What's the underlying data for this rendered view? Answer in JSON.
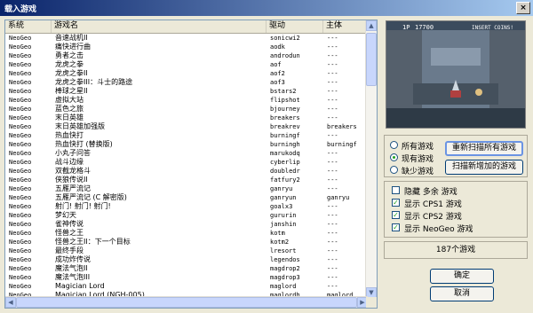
{
  "window": {
    "title": "载入游戏",
    "close_label": "×"
  },
  "columns": [
    "系统",
    "游戏名",
    "驱动",
    "主体"
  ],
  "rows": [
    [
      "NeoGeo",
      "音速战机II",
      "sonicwi2",
      "---"
    ],
    [
      "NeoGeo",
      "痛快进行曲",
      "aodk",
      "---"
    ],
    [
      "NeoGeo",
      "勇者之击",
      "androdun",
      "---"
    ],
    [
      "NeoGeo",
      "龙虎之拳",
      "aof",
      "---"
    ],
    [
      "NeoGeo",
      "龙虎之拳II",
      "aof2",
      "---"
    ],
    [
      "NeoGeo",
      "龙虎之拳III：斗士的路途",
      "aof3",
      "---"
    ],
    [
      "NeoGeo",
      "棒球之星II",
      "bstars2",
      "---"
    ],
    [
      "NeoGeo",
      "虚拟大站",
      "flipshot",
      "---"
    ],
    [
      "NeoGeo",
      "蓝色之旅",
      "bjourney",
      "---"
    ],
    [
      "NeoGeo",
      "末日英雄",
      "breakers",
      "---"
    ],
    [
      "NeoGeo",
      "末日英雄加强版",
      "breakrev",
      "breakers"
    ],
    [
      "NeoGeo",
      "热血快打",
      "burningf",
      "---"
    ],
    [
      "NeoGeo",
      "热血快打 (替换版)",
      "burningh",
      "burningf"
    ],
    [
      "NeoGeo",
      "小丸子问答",
      "marukodq",
      "---"
    ],
    [
      "NeoGeo",
      "战斗边缘",
      "cyberlip",
      "---"
    ],
    [
      "NeoGeo",
      "双截龙格斗",
      "doubledr",
      "---"
    ],
    [
      "NeoGeo",
      "侠狼传说II",
      "fatfury2",
      "---"
    ],
    [
      "NeoGeo",
      "五雁严流记",
      "ganryu",
      "---"
    ],
    [
      "NeoGeo",
      "五雁严流记 (C 解密版)",
      "ganryun",
      "ganryu"
    ],
    [
      "NeoGeo",
      "射门! 射门! 射门!",
      "goalx3",
      "---"
    ],
    [
      "NeoGeo",
      "梦幻天",
      "gururin",
      "---"
    ],
    [
      "NeoGeo",
      "雀神传说",
      "janshin",
      "---"
    ],
    [
      "NeoGeo",
      "怪兽之王",
      "kotm",
      "---"
    ],
    [
      "NeoGeo",
      "怪兽之王II：下一个目标",
      "kotm2",
      "---"
    ],
    [
      "NeoGeo",
      "最终手段",
      "lresort",
      "---"
    ],
    [
      "NeoGeo",
      "成功炸传说",
      "legendos",
      "---"
    ],
    [
      "NeoGeo",
      "魔法气泡II",
      "magdrop2",
      "---"
    ],
    [
      "NeoGeo",
      "魔法气泡III",
      "magdrop3",
      "---"
    ],
    [
      "NeoGeo",
      "Magician Lord",
      "maglord",
      "---"
    ],
    [
      "NeoGeo",
      "Magician Lord (NGH-005)",
      "maglordh",
      "maglord"
    ]
  ],
  "preview": {
    "score_label": "1P",
    "score": "17700",
    "insert_text": "INSERT COINS!"
  },
  "radio_options": [
    {
      "label": "所有游戏",
      "selected": false
    },
    {
      "label": "现有游戏",
      "selected": true
    },
    {
      "label": "缺少游戏",
      "selected": false
    }
  ],
  "buttons": {
    "rescan_all": "重新扫描所有游戏",
    "scan_new": "扫描新增加的游戏",
    "ok": "确定",
    "cancel": "取消"
  },
  "filters": [
    {
      "label": "隐藏 多余 游戏",
      "checked": false
    },
    {
      "label": "显示 CPS1 游戏",
      "checked": true
    },
    {
      "label": "显示 CPS2 游戏",
      "checked": true
    },
    {
      "label": "显示 NeoGeo 游戏",
      "checked": true
    }
  ],
  "game_count": "187个游戏",
  "colors": {
    "title_start": "#0a246a",
    "title_end": "#a6caf0",
    "check": "#21a121"
  }
}
